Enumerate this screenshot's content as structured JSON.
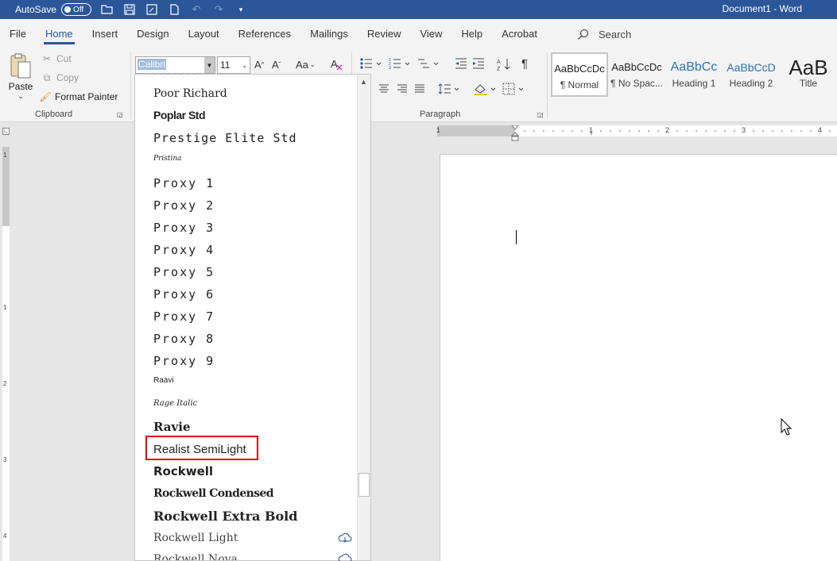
{
  "titlebar": {
    "autosave_label": "AutoSave",
    "autosave_state": "Off",
    "document_title": "Document1  -  Word"
  },
  "tabs": [
    {
      "label": "File"
    },
    {
      "label": "Home",
      "active": true
    },
    {
      "label": "Insert"
    },
    {
      "label": "Design"
    },
    {
      "label": "Layout"
    },
    {
      "label": "References"
    },
    {
      "label": "Mailings"
    },
    {
      "label": "Review"
    },
    {
      "label": "View"
    },
    {
      "label": "Help"
    },
    {
      "label": "Acrobat"
    }
  ],
  "search": {
    "label": "Search"
  },
  "clipboard": {
    "paste_label": "Paste",
    "cut_label": "Cut",
    "copy_label": "Copy",
    "format_painter_label": "Format Painter",
    "group_label": "Clipboard"
  },
  "font": {
    "current_font": "Calibri",
    "current_size": "11",
    "change_case_label": "Aa"
  },
  "paragraph": {
    "group_label": "Paragraph"
  },
  "styles": [
    {
      "preview": "AaBbCcDc",
      "name": "¶ Normal",
      "selected": true
    },
    {
      "preview": "AaBbCcDc",
      "name": "¶ No Spac..."
    },
    {
      "preview": "AaBbCc",
      "name": "Heading 1"
    },
    {
      "preview": "AaBbCcD",
      "name": "Heading 2"
    },
    {
      "preview": "AaB",
      "name": "Title"
    }
  ],
  "ruler": {
    "h_numbers": [
      "1",
      "1",
      "2",
      "3",
      "4"
    ],
    "v_numbers": [
      "1",
      "1",
      "2",
      "3",
      "4"
    ]
  },
  "font_list": [
    {
      "name": "Poor Richard"
    },
    {
      "name": "Poplar Std"
    },
    {
      "name": "Prestige Elite Std"
    },
    {
      "name": "Pristina"
    },
    {
      "name": "Proxy 1"
    },
    {
      "name": "Proxy 2"
    },
    {
      "name": "Proxy 3"
    },
    {
      "name": "Proxy 4"
    },
    {
      "name": "Proxy 5"
    },
    {
      "name": "Proxy 6"
    },
    {
      "name": "Proxy 7"
    },
    {
      "name": "Proxy 8"
    },
    {
      "name": "Proxy 9"
    },
    {
      "name": "Raavi"
    },
    {
      "name": "Rage Italic"
    },
    {
      "name": "Ravie"
    },
    {
      "name": "Realist SemiLight",
      "highlighted": true
    },
    {
      "name": "Rockwell"
    },
    {
      "name": "Rockwell Condensed"
    },
    {
      "name": "Rockwell Extra Bold"
    },
    {
      "name": "Rockwell Light",
      "cloud": true
    },
    {
      "name": "Rockwell Nova",
      "cloud": true
    }
  ],
  "colors": {
    "accent": "#2b579a",
    "highlight_border": "#e00000"
  }
}
